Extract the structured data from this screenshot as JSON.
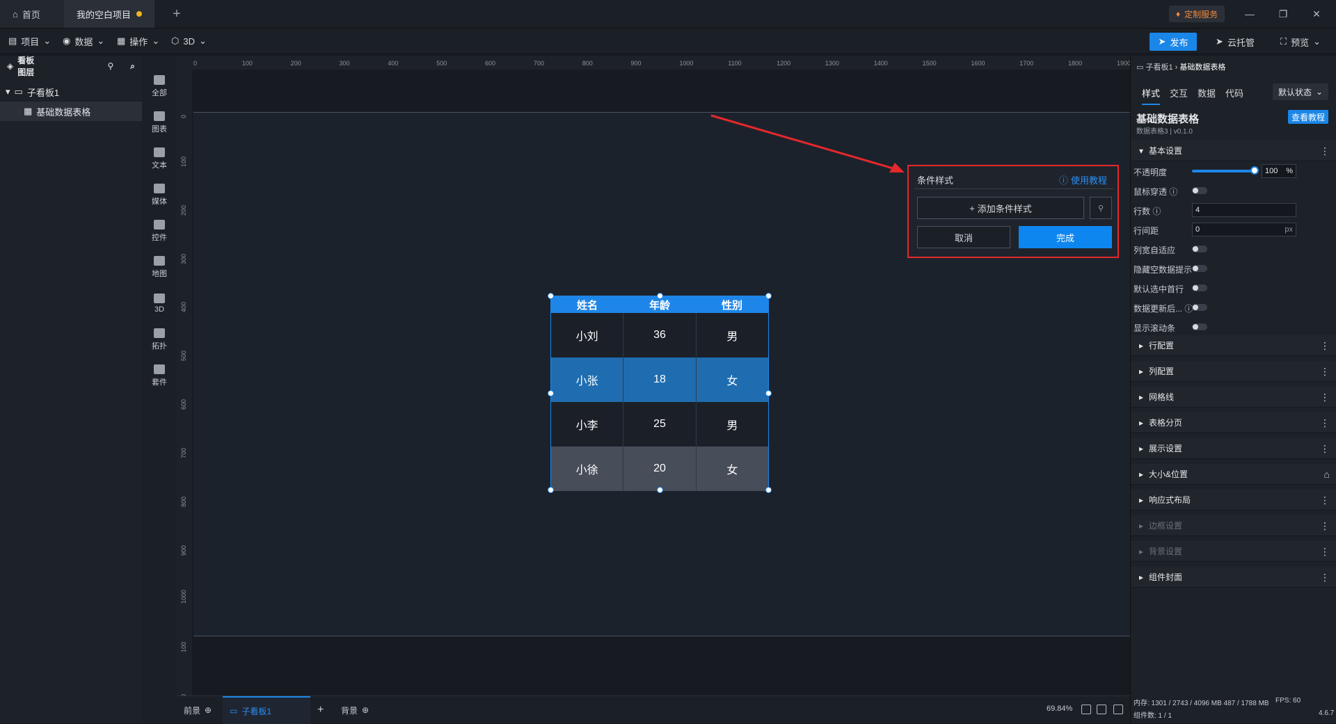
{
  "tabs": {
    "home": "首页",
    "project": "我的空白项目"
  },
  "custom_service": "定制服务",
  "menu": {
    "project": "项目",
    "data": "数据",
    "operate": "操作",
    "three_d": "3D"
  },
  "actions": {
    "publish": "发布",
    "cloud": "云托管",
    "preview": "预览"
  },
  "layers": {
    "title": "看板图层",
    "board": "子看板1",
    "table": "基础数据表格"
  },
  "components": [
    {
      "label": "全部",
      "icon": "grid-icon"
    },
    {
      "label": "图表",
      "icon": "chart-icon"
    },
    {
      "label": "文本",
      "icon": "text-icon"
    },
    {
      "label": "媒体",
      "icon": "media-icon"
    },
    {
      "label": "控件",
      "icon": "control-icon"
    },
    {
      "label": "地图",
      "icon": "map-icon"
    },
    {
      "label": "3D",
      "icon": "cube-icon"
    },
    {
      "label": "拓扑",
      "icon": "topology-icon"
    },
    {
      "label": "套件",
      "icon": "kit-icon"
    }
  ],
  "ruler_top": [
    "0",
    "100",
    "200",
    "300",
    "400",
    "500",
    "600",
    "700",
    "800",
    "900",
    "1000",
    "1100",
    "1200",
    "1300",
    "1400",
    "1500",
    "1600",
    "1700",
    "1800",
    "1900"
  ],
  "ruler_left": [
    "0",
    "100",
    "200",
    "300",
    "400",
    "500",
    "600",
    "700",
    "800",
    "900",
    "1000",
    "100",
    "00"
  ],
  "table": {
    "headers": [
      "姓名",
      "年龄",
      "性别"
    ],
    "rows": [
      [
        "小刘",
        "36",
        "男"
      ],
      [
        "小张",
        "18",
        "女"
      ],
      [
        "小李",
        "25",
        "男"
      ],
      [
        "小徐",
        "20",
        "女"
      ]
    ],
    "row_colors": [
      "#1b2028",
      "#1f6db0",
      "#1b2028",
      "#474d59"
    ]
  },
  "popup": {
    "title": "条件样式",
    "help": "使用教程",
    "add": "添加条件样式",
    "cancel": "取消",
    "done": "完成"
  },
  "bottom": {
    "foreground": "前景",
    "board": "子看板1",
    "background": "背景",
    "zoom": "69.84%"
  },
  "right": {
    "crumb_parent": "子看板1",
    "crumb_current": "基础数据表格",
    "tabs": [
      "样式",
      "交互",
      "数据",
      "代码"
    ],
    "state": "默认状态",
    "name": "基础数据表格",
    "version": "数据表格3 | v0.1.0",
    "tutorial": "查看教程",
    "basic": "基本设置",
    "props": {
      "opacity": "不透明度",
      "opacity_val": "100",
      "opacity_unit": "%",
      "mouse": "鼠标穿透",
      "rows": "行数",
      "rows_val": "4",
      "row_gap": "行间距",
      "row_gap_val": "0",
      "row_gap_unit": "px",
      "col_auto": "列宽自适应",
      "hide_empty": "隐藏空数据提示",
      "select_first": "默认选中首行",
      "data_update": "数据更新后...",
      "scrollbar": "显示滚动条"
    },
    "sections": [
      "行配置",
      "列配置",
      "网格线",
      "表格分页",
      "展示设置",
      "大小&位置",
      "响应式布局",
      "边框设置",
      "背景设置",
      "组件封面"
    ],
    "stats": "内存: 1301 / 2743 / 4096 MB  487 / 1788 MB",
    "fps": "FPS: 60",
    "count": "组件数: 1 / 1",
    "ver": "4.6.7"
  }
}
